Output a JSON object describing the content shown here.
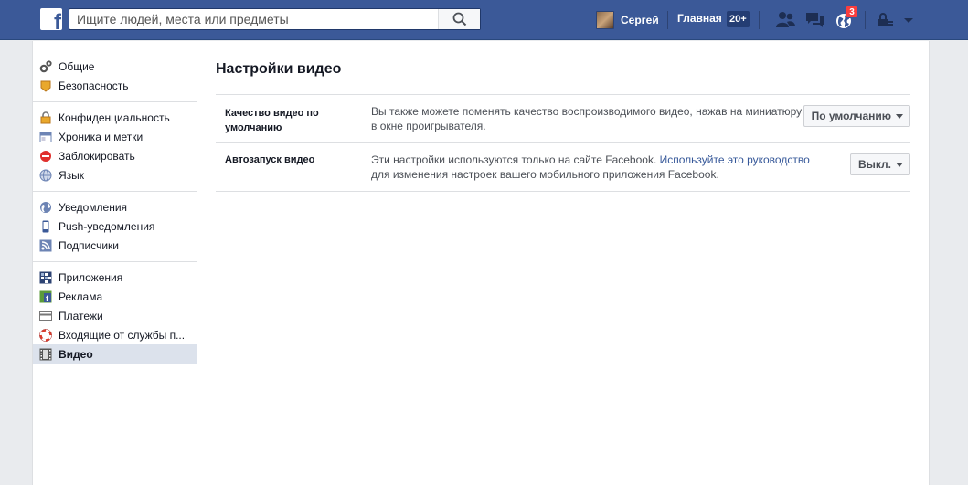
{
  "topbar": {
    "logo": "f",
    "search_placeholder": "Ищите людей, места или предметы",
    "user_name": "Сергей",
    "home_label": "Главная",
    "home_count": "20+",
    "notifications_count": "3",
    "icons": [
      "friends-icon",
      "messages-icon",
      "notifications-icon",
      "privacy-icon",
      "chevron-down-icon"
    ]
  },
  "sidebar": {
    "groups": [
      {
        "items": [
          {
            "label": "Общие",
            "icon": "gear-icon"
          },
          {
            "label": "Безопасность",
            "icon": "badge-icon"
          }
        ]
      },
      {
        "items": [
          {
            "label": "Конфиденциальность",
            "icon": "lock-icon"
          },
          {
            "label": "Хроника и метки",
            "icon": "timeline-icon"
          },
          {
            "label": "Заблокировать",
            "icon": "block-icon"
          },
          {
            "label": "Язык",
            "icon": "globe-icon"
          }
        ]
      },
      {
        "items": [
          {
            "label": "Уведомления",
            "icon": "notifications-globe-icon"
          },
          {
            "label": "Push-уведомления",
            "icon": "mobile-icon"
          },
          {
            "label": "Подписчики",
            "icon": "rss-icon"
          }
        ]
      },
      {
        "items": [
          {
            "label": "Приложения",
            "icon": "apps-icon"
          },
          {
            "label": "Реклама",
            "icon": "ads-icon"
          },
          {
            "label": "Платежи",
            "icon": "card-icon"
          },
          {
            "label": "Входящие от службы п...",
            "icon": "lifebuoy-icon"
          },
          {
            "label": "Видео",
            "icon": "film-icon",
            "active": true
          }
        ]
      }
    ]
  },
  "content": {
    "title": "Настройки видео",
    "rows": [
      {
        "label": "Качество видео по умолчанию",
        "description": "Вы также можете поменять качество воспроизводимого видео, нажав на миниатюру HD в окне проигрывателя.",
        "select_value": "По умолчанию"
      },
      {
        "label": "Автозапуск видео",
        "description_before": "Эти настройки используются только на сайте Facebook. ",
        "description_link": "Используйте это руководство",
        "description_after": " для изменения настроек вашего мобильного приложения Facebook.",
        "select_value": "Выкл."
      }
    ]
  },
  "colors": {
    "brand": "#3b5998",
    "link": "#365899",
    "active_bg": "#dce2ec",
    "badge": "#fa3e3e"
  }
}
